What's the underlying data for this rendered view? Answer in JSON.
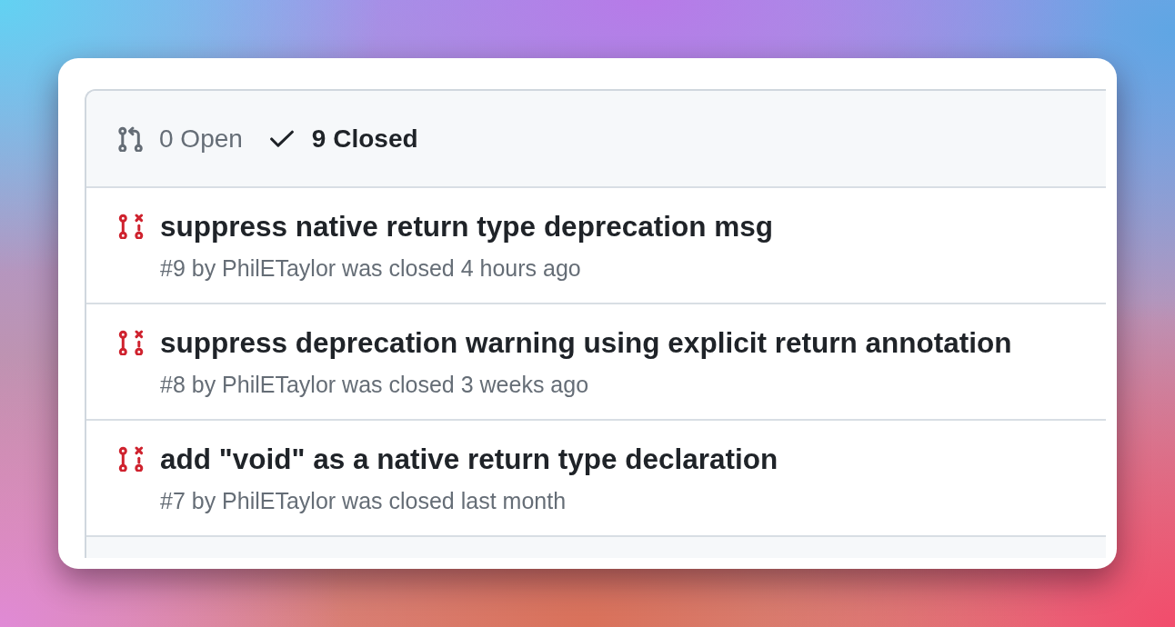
{
  "filters": [
    {
      "kind": "open",
      "label": "0 Open",
      "selected": false
    },
    {
      "kind": "closed",
      "label": "9 Closed",
      "selected": true
    }
  ],
  "pull_requests": [
    {
      "closed": true,
      "title": "suppress native return type deprecation msg",
      "meta": "#9 by PhilETaylor was closed 4 hours ago"
    },
    {
      "closed": true,
      "title": "suppress deprecation warning using explicit return annotation",
      "meta": "#8 by PhilETaylor was closed 3 weeks ago"
    },
    {
      "closed": true,
      "title": "add \"void\" as a native return type declaration",
      "meta": "#7 by PhilETaylor was closed last month"
    }
  ]
}
